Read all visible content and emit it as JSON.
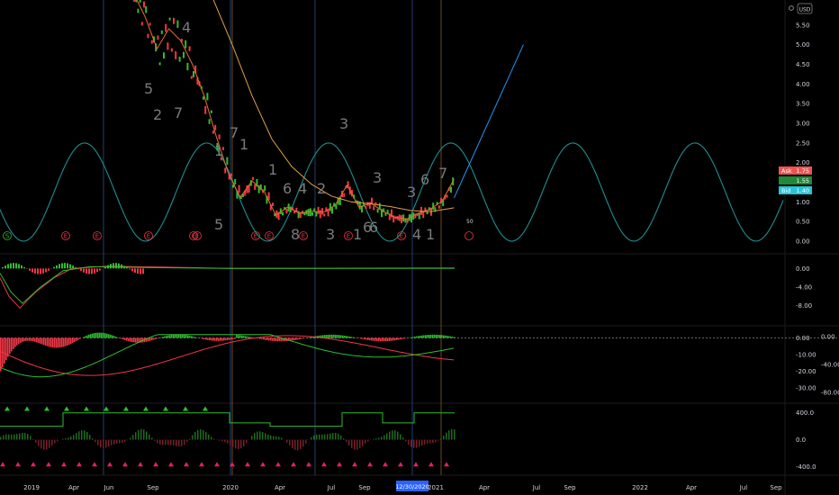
{
  "currency_label": "USD",
  "settings_icon": "gear-icon",
  "colors": {
    "background": "#000000",
    "up": "#2ebd2e",
    "down": "#f23645",
    "sine": "#1f8f8f",
    "projection": "#2196f3",
    "ma_slow": "#e0a040",
    "ma_fast": "#e0a040",
    "ask": "#ef5350",
    "mid": "#26a69a",
    "bid": "#26c6da",
    "date_highlight": "#2962ff",
    "vline_blue": "#2a4f8a",
    "vline_orange": "#8a5a20",
    "vline_olive": "#6b6b20"
  },
  "price_tags": [
    {
      "label": "Ask",
      "value": "1.75",
      "color": "#ef5350"
    },
    {
      "label": "",
      "value": "1.55",
      "color": "#26a69a"
    },
    {
      "label": "Bid",
      "value": "1.40",
      "color": "#26c6da"
    }
  ],
  "highlight_date": "12/30/2020",
  "projection_label": "50",
  "event_markers": [
    {
      "text": "S",
      "color": "#2ebd2e"
    },
    {
      "text": "E",
      "color": "#f23645"
    },
    {
      "text": "E",
      "color": "#f23645"
    },
    {
      "text": "E",
      "color": "#f23645"
    },
    {
      "text": "E",
      "color": "#f23645"
    },
    {
      "text": "E",
      "color": "#f23645"
    },
    {
      "text": "E",
      "color": "#f23645"
    },
    {
      "text": "E",
      "color": "#f23645"
    },
    {
      "text": "E",
      "color": "#f23645"
    },
    {
      "text": "E",
      "color": "#f23645"
    },
    {
      "text": "E",
      "color": "#f23645"
    }
  ],
  "count_labels": [
    "5",
    "2",
    "7",
    "4",
    "1",
    "7",
    "1",
    "5",
    "1",
    "6",
    "4",
    "2",
    "8",
    "3",
    "3",
    "1",
    "3",
    "6",
    "6",
    "3",
    "6",
    "4",
    "1",
    "7"
  ],
  "chart_data": {
    "type": "line",
    "x_tick_labels": [
      "2019",
      "Apr",
      "Jun",
      "Sep",
      "2020",
      "Apr",
      "Jul",
      "Sep",
      "2021",
      "Apr",
      "Jul",
      "Sep",
      "2022",
      "Apr",
      "Jul",
      "Sep"
    ],
    "panels": [
      {
        "name": "price",
        "y_ticks": [
          "5.50",
          "5.00",
          "4.50",
          "4.00",
          "3.50",
          "3.00",
          "2.50",
          "2.00",
          "1.50",
          "1.00",
          "0.50",
          "0.00"
        ],
        "ylim": [
          0,
          6.0
        ],
        "price_series": [
          {
            "x": 0.0,
            "close": 6.2
          },
          {
            "x": 0.3,
            "close": 5.6
          },
          {
            "x": 0.6,
            "close": 4.8
          },
          {
            "x": 0.9,
            "close": 5.3
          },
          {
            "x": 1.2,
            "close": 5.0
          },
          {
            "x": 1.5,
            "close": 4.4
          },
          {
            "x": 1.8,
            "close": 3.6
          },
          {
            "x": 2.1,
            "close": 2.6
          },
          {
            "x": 2.4,
            "close": 1.7
          },
          {
            "x": 2.7,
            "close": 1.1
          },
          {
            "x": 3.0,
            "close": 1.5
          },
          {
            "x": 3.3,
            "close": 1.25
          },
          {
            "x": 3.6,
            "close": 0.65
          },
          {
            "x": 3.9,
            "close": 0.85
          },
          {
            "x": 4.2,
            "close": 0.7
          },
          {
            "x": 4.5,
            "close": 0.75
          },
          {
            "x": 4.8,
            "close": 0.72
          },
          {
            "x": 5.1,
            "close": 0.9
          },
          {
            "x": 5.4,
            "close": 1.4
          },
          {
            "x": 5.7,
            "close": 0.85
          },
          {
            "x": 6.0,
            "close": 0.95
          },
          {
            "x": 6.3,
            "close": 0.75
          },
          {
            "x": 6.6,
            "close": 0.6
          },
          {
            "x": 6.9,
            "close": 0.55
          },
          {
            "x": 7.2,
            "close": 0.7
          },
          {
            "x": 7.5,
            "close": 0.8
          },
          {
            "x": 7.8,
            "close": 1.0
          },
          {
            "x": 8.1,
            "close": 1.55
          }
        ],
        "slow_ma": [
          {
            "x": 2.0,
            "y": 6.2
          },
          {
            "x": 2.5,
            "y": 5.0
          },
          {
            "x": 3.0,
            "y": 3.7
          },
          {
            "x": 3.5,
            "y": 2.6
          },
          {
            "x": 4.0,
            "y": 1.9
          },
          {
            "x": 4.5,
            "y": 1.45
          },
          {
            "x": 5.0,
            "y": 1.15
          },
          {
            "x": 5.5,
            "y": 1.0
          },
          {
            "x": 6.0,
            "y": 0.95
          },
          {
            "x": 6.5,
            "y": 0.88
          },
          {
            "x": 7.0,
            "y": 0.78
          },
          {
            "x": 7.5,
            "y": 0.75
          },
          {
            "x": 8.1,
            "y": 0.85
          }
        ],
        "sine": {
          "amplitude": 1.25,
          "mid": 1.25,
          "period_ticks": 2.4
        },
        "projection": [
          {
            "x": 8.1,
            "y": 1.1
          },
          {
            "x": 9.85,
            "y": 5.0
          }
        ]
      },
      {
        "name": "oscillator-1",
        "y_ticks": [
          "0.00",
          "-4.00",
          "-8.00"
        ],
        "ylim": [
          -10,
          2
        ]
      },
      {
        "name": "oscillator-2",
        "y_ticks": [
          "0.00",
          "-10.00",
          "-20.00",
          "-30.00"
        ],
        "y_ticks_right": [
          "0.00",
          "-40.00",
          "-80.00"
        ],
        "ylim": [
          -35,
          3
        ]
      },
      {
        "name": "oscillator-3",
        "y_ticks": [
          "400.0",
          "0.0",
          "-400.0"
        ],
        "ylim": [
          -450,
          450
        ]
      }
    ]
  }
}
